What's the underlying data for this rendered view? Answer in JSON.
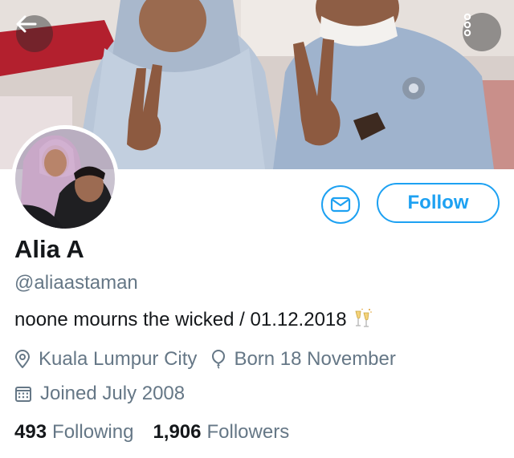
{
  "profile": {
    "name": "Alia A",
    "handle": "@aliaastaman",
    "bio": "noone mourns the wicked / 01.12.2018",
    "location": "Kuala Lumpur City",
    "birthday": "Born 18 November",
    "joined": "Joined July 2008"
  },
  "actions": {
    "follow_label": "Follow"
  },
  "stats": {
    "following_count": "493",
    "following_label": "Following",
    "followers_count": "1,906",
    "followers_label": "Followers"
  },
  "icons": {
    "back": "arrow-left-icon",
    "more": "more-vertical-icon",
    "message": "envelope-icon",
    "location": "location-pin-icon",
    "birthday": "balloon-icon",
    "joined": "calendar-icon",
    "bio_emoji": "champagne-glasses-icon"
  },
  "colors": {
    "accent": "#1da1f2",
    "secondary_text": "#657786",
    "primary_text": "#14171a"
  }
}
